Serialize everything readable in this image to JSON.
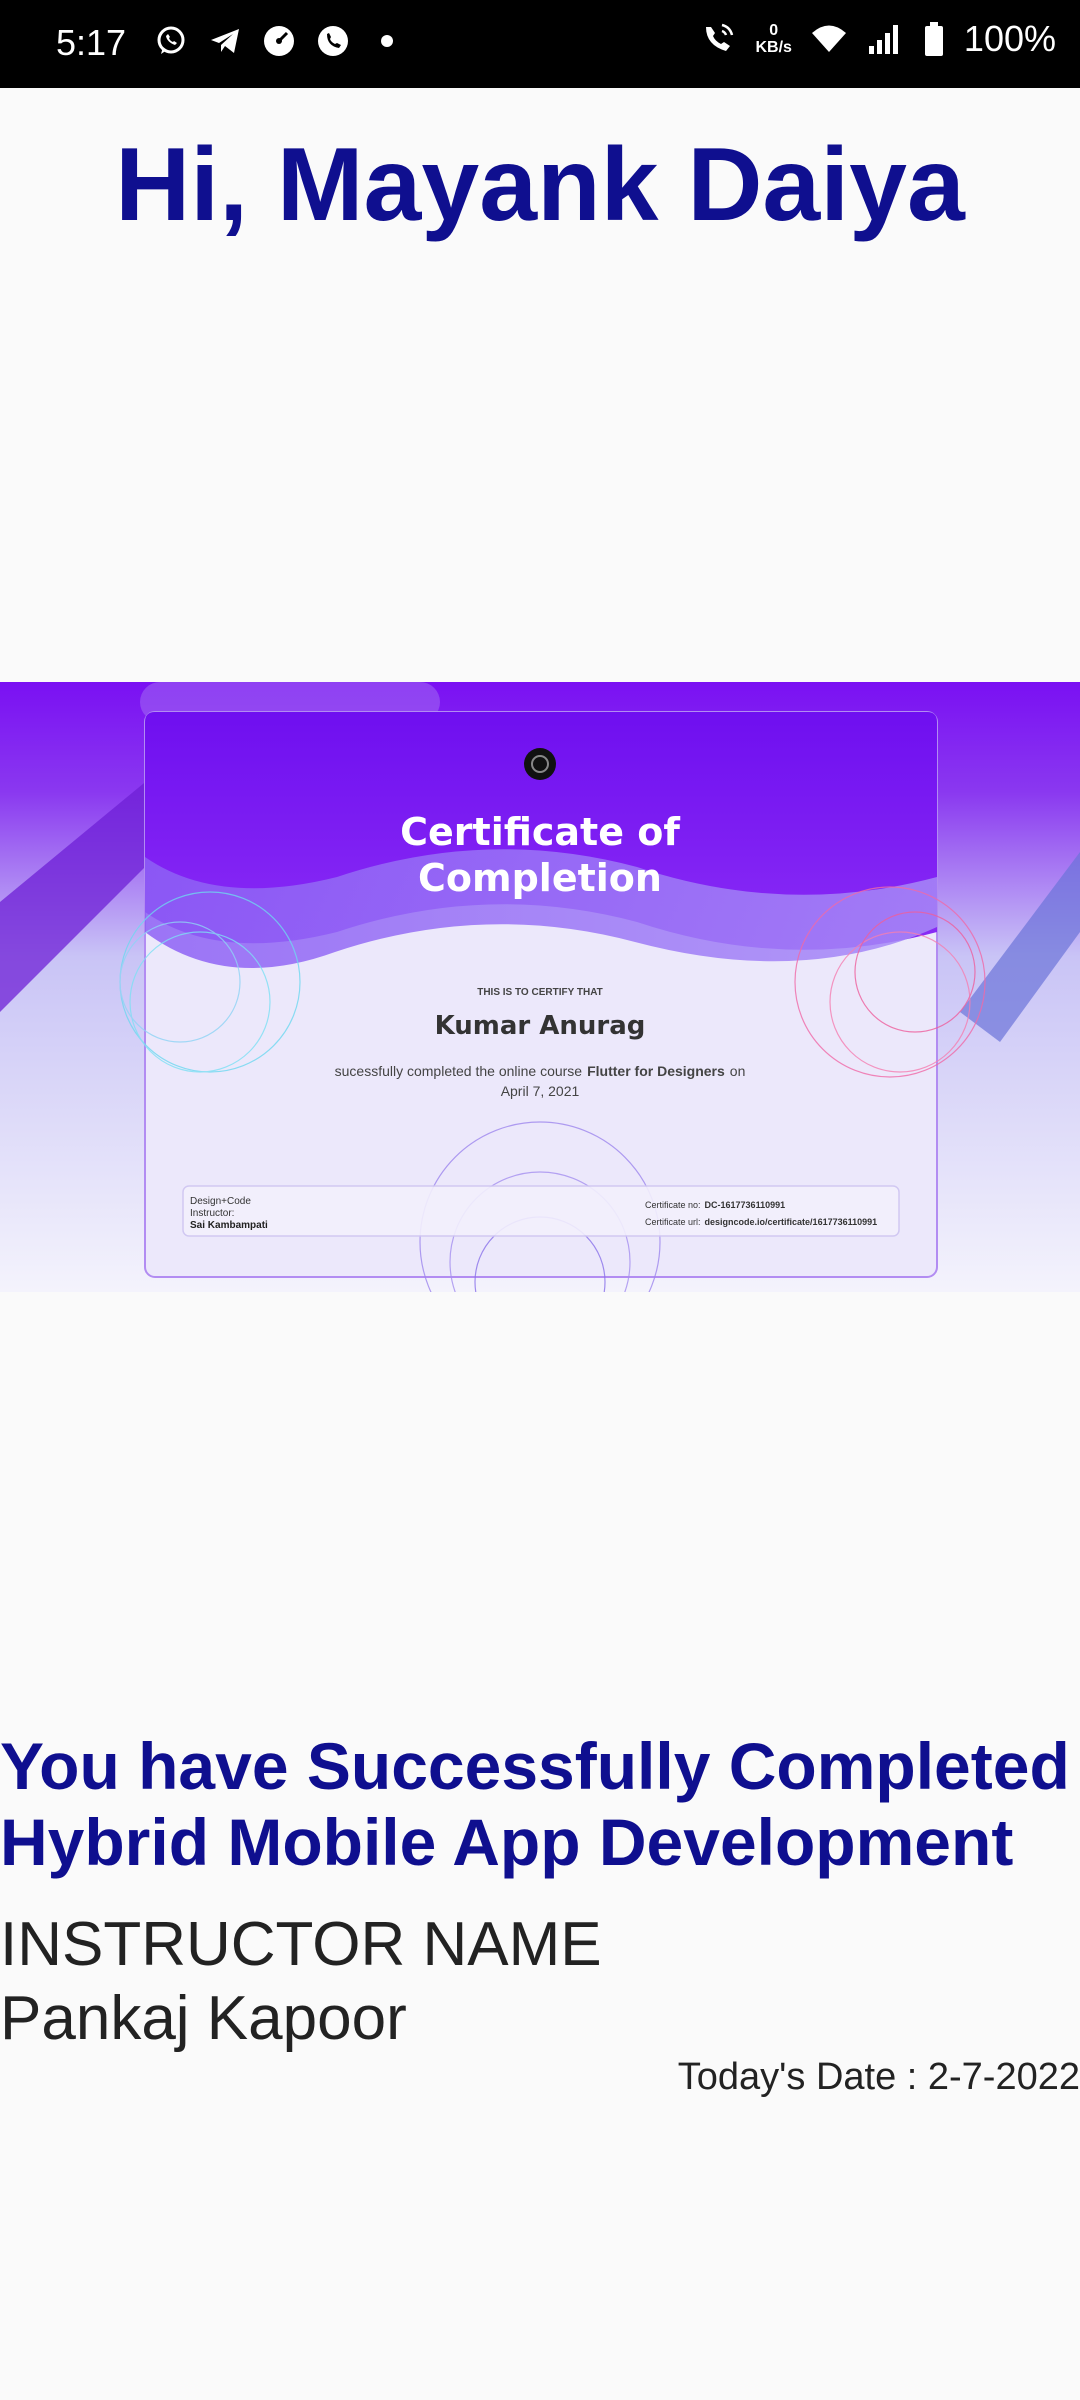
{
  "status_bar": {
    "time": "5:17",
    "net_speed_value": "0",
    "net_speed_unit": "KB/s",
    "battery": "100%"
  },
  "greeting": "Hi, Mayank Daiya",
  "certificate": {
    "title_line1": "Certificate of",
    "title_line2": "Completion",
    "certify_text": "THIS IS TO CERTIFY THAT",
    "recipient": "Kumar Anurag",
    "course_prefix": "sucessfully completed the online course",
    "course_name": "Flutter for Designers",
    "course_suffix": "on",
    "date": "April 7, 2021",
    "org": "Design+Code",
    "instructor_label": "Instructor:",
    "instructor": "Sai Kambampati",
    "cert_no_label": "Certificate no:",
    "cert_no": "DC-1617736110991",
    "cert_url_label": "Certificate url:",
    "cert_url": "designcode.io/certificate/1617736110991"
  },
  "completed_line1": "You have Successfully Completed",
  "completed_line2": "Hybrid Mobile App Development",
  "instructor_heading": "INSTRUCTOR NAME",
  "instructor_name": "Pankaj Kapoor",
  "todays_date": "Today's Date : 2-7-2022",
  "colors": {
    "heading": "#0f0f8f",
    "body_text": "#222222",
    "background": "#fafafa",
    "cert_purple": "#7b16f0"
  }
}
